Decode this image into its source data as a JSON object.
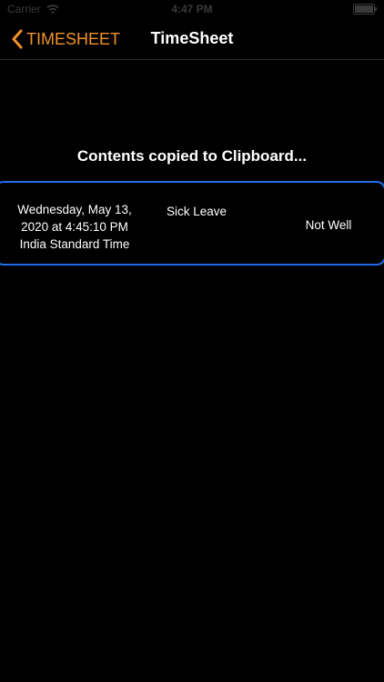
{
  "status_bar": {
    "carrier": "Carrier",
    "time": "4:47 PM"
  },
  "nav": {
    "back_label": "TIMESHEET",
    "title": "TimeSheet"
  },
  "toast": {
    "message": "Contents copied to Clipboard..."
  },
  "entry": {
    "date_line1": "Wednesday, May 13,",
    "date_line2": "2020 at 4:45:10 PM",
    "date_line3": "India Standard Time",
    "type": "Sick Leave",
    "reason": "Not Well"
  },
  "colors": {
    "accent": "#f0922a",
    "selection_border": "#1f6de8",
    "background": "#000000",
    "text": "#ffffff"
  },
  "icons": {
    "back": "chevron-left-icon",
    "wifi": "wifi-icon",
    "battery": "battery-icon"
  }
}
